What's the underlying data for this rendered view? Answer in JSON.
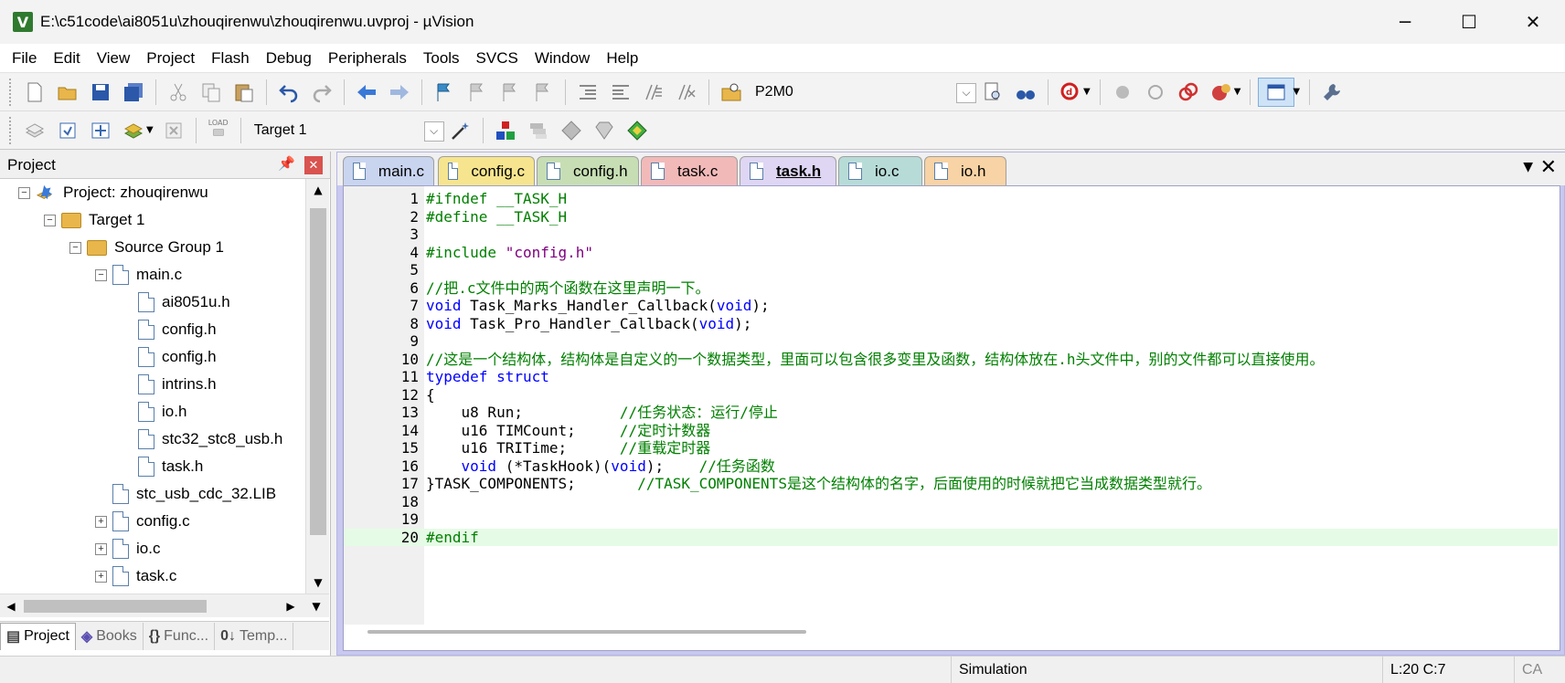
{
  "window": {
    "title": "E:\\c51code\\ai8051u\\zhouqirenwu\\zhouqirenwu.uvproj - µVision",
    "app_icon": "V",
    "controls": [
      "─",
      "☐",
      "✕"
    ]
  },
  "menu": [
    "File",
    "Edit",
    "View",
    "Project",
    "Flash",
    "Debug",
    "Peripherals",
    "Tools",
    "SVCS",
    "Window",
    "Help"
  ],
  "toolbar1": {
    "find_combo": "P2M0"
  },
  "toolbar2": {
    "load_label": "LOAD",
    "target_combo": "Target 1"
  },
  "project_panel": {
    "title": "Project",
    "pin": "📌",
    "close": "✕",
    "tree": [
      {
        "label": "Project: zhouqirenwu",
        "kind": "project",
        "depth": 0,
        "expander": "−"
      },
      {
        "label": "Target 1",
        "kind": "folder",
        "depth": 1,
        "expander": "−"
      },
      {
        "label": "Source Group 1",
        "kind": "folder",
        "depth": 2,
        "expander": "−"
      },
      {
        "label": "main.c",
        "kind": "file",
        "depth": 3,
        "expander": "−"
      },
      {
        "label": "ai8051u.h",
        "kind": "file",
        "depth": 4,
        "expander": ""
      },
      {
        "label": "config.h",
        "kind": "file",
        "depth": 4,
        "expander": ""
      },
      {
        "label": "config.h",
        "kind": "file",
        "depth": 4,
        "expander": ""
      },
      {
        "label": "intrins.h",
        "kind": "file",
        "depth": 4,
        "expander": ""
      },
      {
        "label": "io.h",
        "kind": "file",
        "depth": 4,
        "expander": ""
      },
      {
        "label": "stc32_stc8_usb.h",
        "kind": "file",
        "depth": 4,
        "expander": ""
      },
      {
        "label": "task.h",
        "kind": "file",
        "depth": 4,
        "expander": ""
      },
      {
        "label": "stc_usb_cdc_32.LIB",
        "kind": "file",
        "depth": 3,
        "expander": ""
      },
      {
        "label": "config.c",
        "kind": "file",
        "depth": 3,
        "expander": "+"
      },
      {
        "label": "io.c",
        "kind": "file",
        "depth": 3,
        "expander": "+"
      },
      {
        "label": "task.c",
        "kind": "file",
        "depth": 3,
        "expander": "+"
      }
    ],
    "tabs": [
      {
        "label": "Project",
        "icon": "▤",
        "active": true
      },
      {
        "label": "Books",
        "icon": "◈",
        "active": false
      },
      {
        "label": "Func...",
        "icon": "{}",
        "active": false
      },
      {
        "label": "Temp...",
        "icon": "0↓",
        "active": false
      }
    ]
  },
  "editor": {
    "tabs": [
      {
        "label": "main.c",
        "color": "#c9d4ef",
        "active": false
      },
      {
        "label": "config.c",
        "color": "#f6e58e",
        "active": false
      },
      {
        "label": "config.h",
        "color": "#c7deb4",
        "active": false
      },
      {
        "label": "task.c",
        "color": "#f2b9b9",
        "active": false
      },
      {
        "label": "task.h",
        "color": "#ded6f3",
        "active": true
      },
      {
        "label": "io.c",
        "color": "#b7dcd8",
        "active": false
      },
      {
        "label": "io.h",
        "color": "#f8d3a5",
        "active": false
      }
    ],
    "tab_menu": "▼",
    "tab_close": "✕",
    "current_line": 20,
    "lines": [
      [
        {
          "t": "#ifndef __TASK_H",
          "c": "pp"
        }
      ],
      [
        {
          "t": "#define __TASK_H",
          "c": "pp"
        }
      ],
      [],
      [
        {
          "t": "#include ",
          "c": "pp"
        },
        {
          "t": "\"config.h\"",
          "c": "st"
        }
      ],
      [],
      [
        {
          "t": "//把.c文件中的两个函数在这里声明一下。",
          "c": "cm"
        }
      ],
      [
        {
          "t": "void",
          "c": "kw"
        },
        {
          "t": " Task_Marks_Handler_Callback(",
          "c": ""
        },
        {
          "t": "void",
          "c": "kw"
        },
        {
          "t": ");",
          "c": ""
        }
      ],
      [
        {
          "t": "void",
          "c": "kw"
        },
        {
          "t": " Task_Pro_Handler_Callback(",
          "c": ""
        },
        {
          "t": "void",
          "c": "kw"
        },
        {
          "t": ");",
          "c": ""
        }
      ],
      [],
      [
        {
          "t": "//这是一个结构体，结构体是自定义的一个数据类型，里面可以包含很多变里及函数，结构体放在.h头文件中，别的文件都可以直接使用。",
          "c": "cm"
        }
      ],
      [
        {
          "t": "typedef",
          "c": "kw"
        },
        {
          "t": " ",
          "c": ""
        },
        {
          "t": "struct",
          "c": "kw"
        }
      ],
      [
        {
          "t": "{",
          "c": ""
        }
      ],
      [
        {
          "t": "    u8 Run;           ",
          "c": ""
        },
        {
          "t": "//任务状态：运行/停止",
          "c": "cm"
        }
      ],
      [
        {
          "t": "    u16 TIMCount;     ",
          "c": ""
        },
        {
          "t": "//定时计数器",
          "c": "cm"
        }
      ],
      [
        {
          "t": "    u16 TRITime;      ",
          "c": ""
        },
        {
          "t": "//重载定时器",
          "c": "cm"
        }
      ],
      [
        {
          "t": "    ",
          "c": ""
        },
        {
          "t": "void",
          "c": "kw"
        },
        {
          "t": " (*TaskHook)(",
          "c": ""
        },
        {
          "t": "void",
          "c": "kw"
        },
        {
          "t": ");    ",
          "c": ""
        },
        {
          "t": "//任务函数",
          "c": "cm"
        }
      ],
      [
        {
          "t": "}TASK_COMPONENTS;       ",
          "c": ""
        },
        {
          "t": "//TASK_COMPONENTS是这个结构体的名字，后面使用的时候就把它当成数据类型就行。",
          "c": "cm"
        }
      ],
      [],
      [],
      [
        {
          "t": "#endif",
          "c": "pp"
        }
      ]
    ]
  },
  "status": {
    "mode": "Simulation",
    "position": "L:20 C:7",
    "flag": "CA"
  }
}
